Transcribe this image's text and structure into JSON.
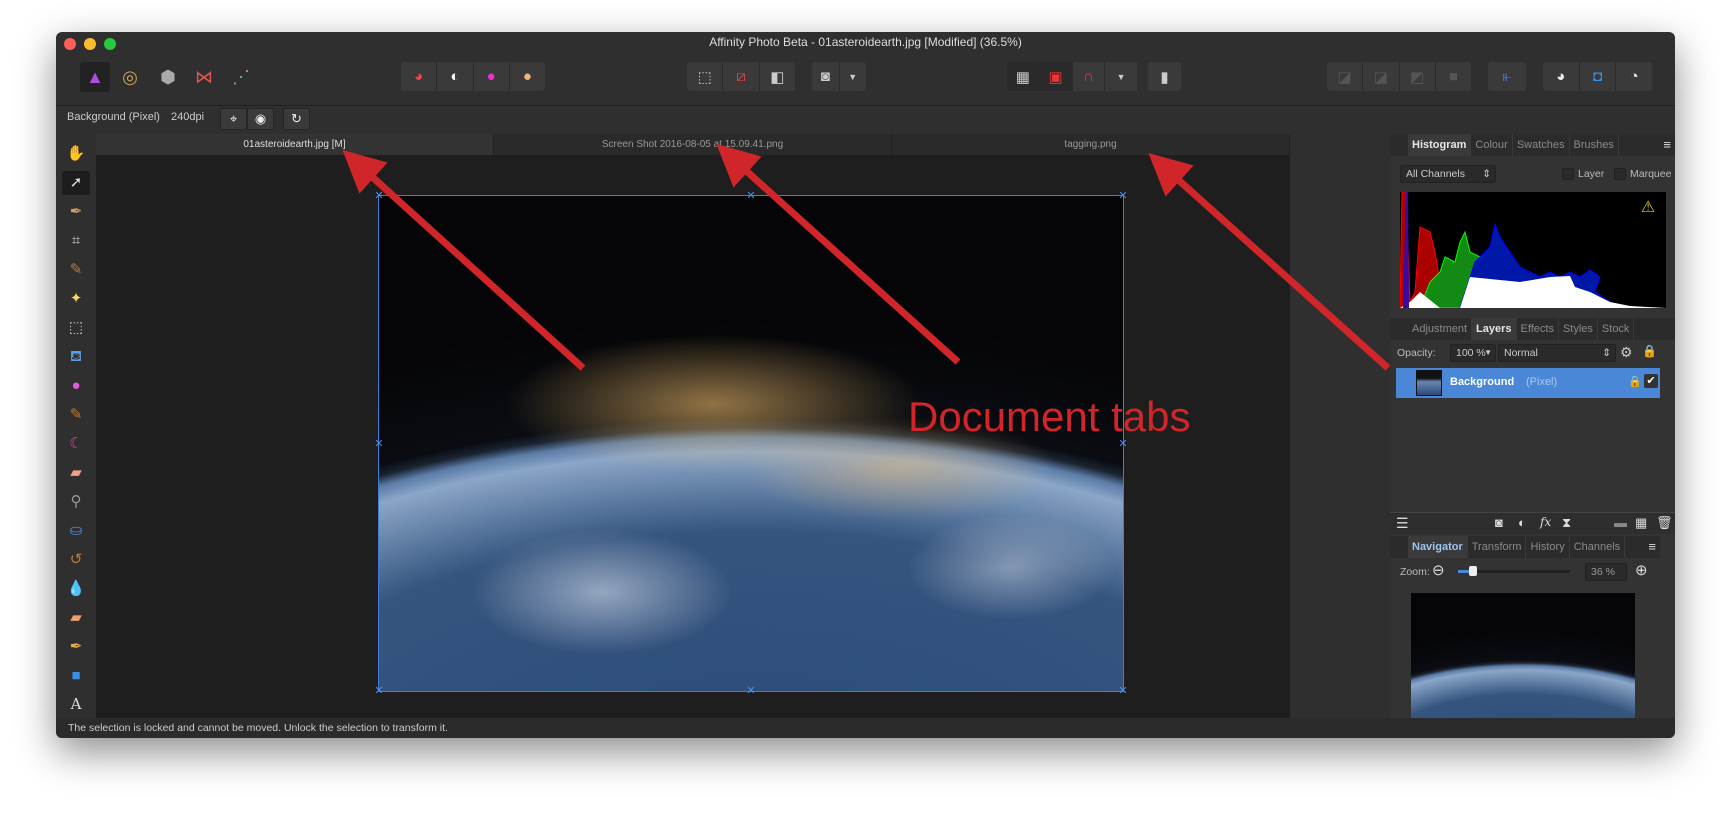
{
  "window": {
    "title": "Affinity Photo Beta - 01asteroidearth.jpg [Modified] (36.5%)"
  },
  "context_bar": {
    "layer_label": "Background (Pixel)",
    "dpi": "240dpi"
  },
  "document_tabs": [
    {
      "label": "01asteroidearth.jpg [M]",
      "active": true
    },
    {
      "label": "Screen Shot 2016-08-05 at 15.09.41.png",
      "active": false
    },
    {
      "label": "tagging.png",
      "active": false
    }
  ],
  "annotation": {
    "text": "Document tabs",
    "color": "#d0262a"
  },
  "status": "The selection is locked and cannot be moved. Unlock the selection to transform it.",
  "histogram_panel": {
    "tabs": [
      "Histogram",
      "Colour",
      "Swatches",
      "Brushes"
    ],
    "channel": "All Channels",
    "layer_label": "Layer",
    "marquee_label": "Marquee"
  },
  "layers_panel": {
    "tabs": [
      "Adjustment",
      "Layers",
      "Effects",
      "Styles",
      "Stock"
    ],
    "opacity_label": "Opacity:",
    "opacity": "100 %",
    "blend_mode": "Normal",
    "layers": [
      {
        "name": "Background",
        "type": "(Pixel)",
        "visible": true,
        "locked": true
      }
    ]
  },
  "navigator_panel": {
    "tabs": [
      "Navigator",
      "Transform",
      "History",
      "Channels"
    ],
    "zoom_label": "Zoom:",
    "zoom_value": "36 %",
    "zoom_slider_fraction": 0.13
  }
}
